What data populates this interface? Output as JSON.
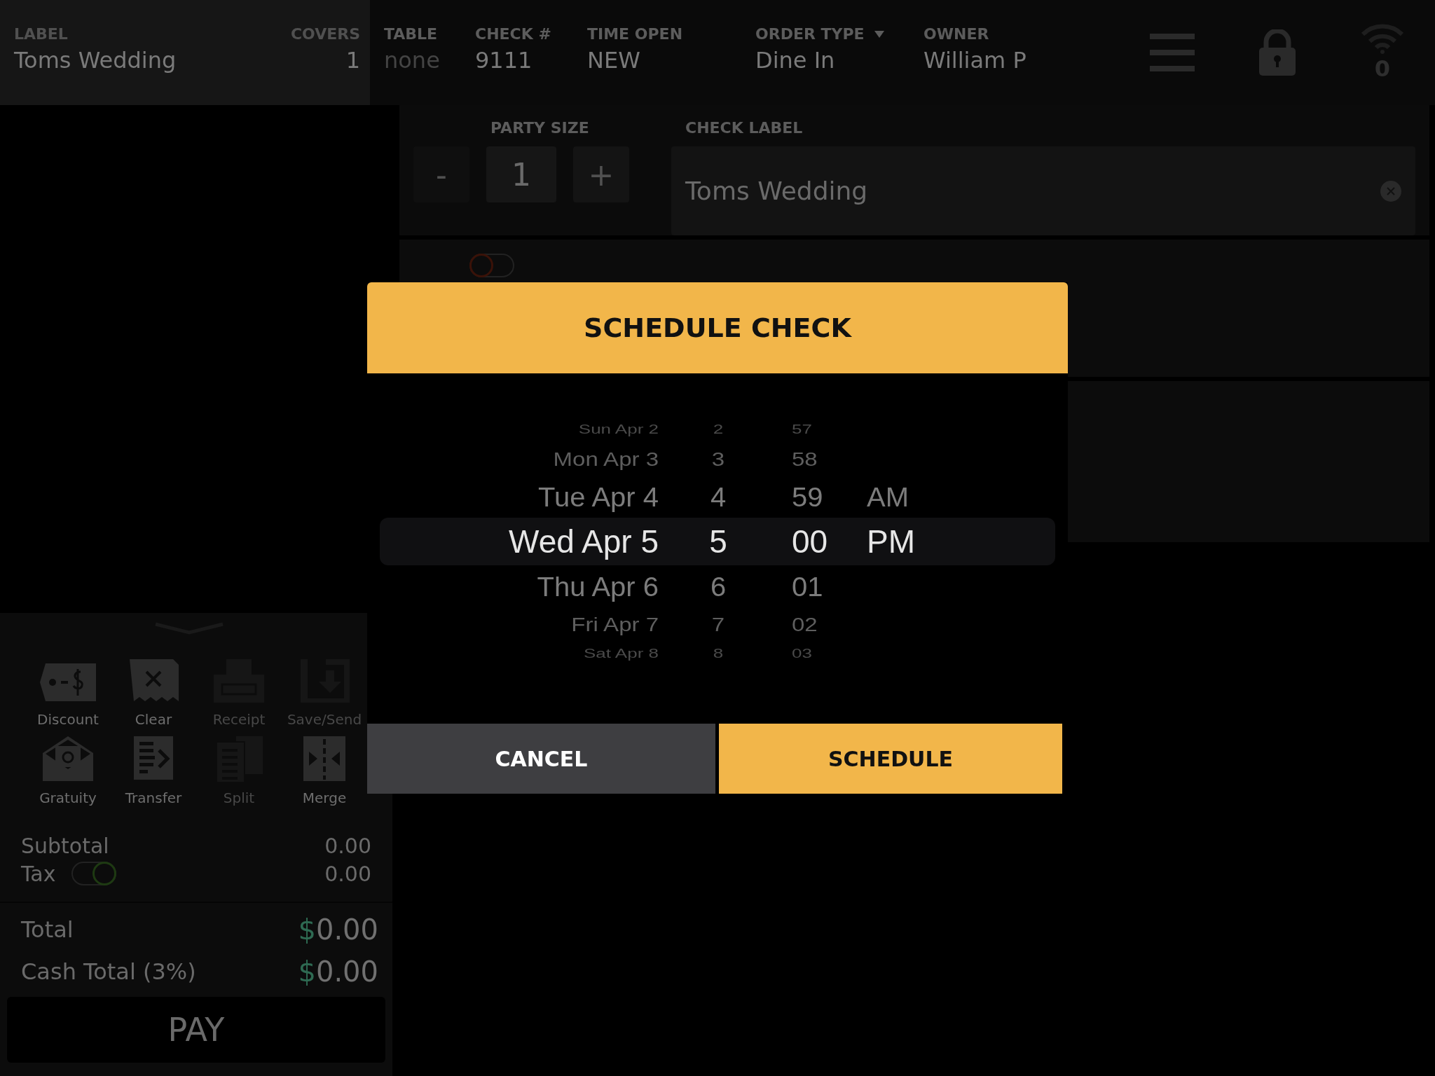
{
  "header": {
    "label": {
      "caption": "LABEL",
      "value": "Toms Wedding"
    },
    "covers": {
      "caption": "COVERS",
      "value": "1"
    },
    "fields": [
      {
        "caption": "TABLE",
        "value": "none",
        "disabled": true
      },
      {
        "caption": "CHECK #",
        "value": "9111",
        "disabled": false
      },
      {
        "caption": "TIME OPEN",
        "value": "NEW",
        "disabled": false
      },
      {
        "caption": "ORDER TYPE",
        "value": "Dine In",
        "disabled": false,
        "dropdown": true
      },
      {
        "caption": "OWNER",
        "value": "William P",
        "disabled": false
      }
    ],
    "wifi_count": "0"
  },
  "party": {
    "caption": "PARTY SIZE",
    "minus": "-",
    "value": "1",
    "plus": "+"
  },
  "check_label": {
    "caption": "CHECK LABEL",
    "value": "Toms Wedding"
  },
  "toggle": {
    "on": false
  },
  "actions": [
    {
      "label": "Discount",
      "disabled": false
    },
    {
      "label": "Clear",
      "disabled": false
    },
    {
      "label": "Receipt",
      "disabled": true
    },
    {
      "label": "Save/Send",
      "disabled": true
    },
    {
      "label": "Gratuity",
      "disabled": false
    },
    {
      "label": "Transfer",
      "disabled": false
    },
    {
      "label": "Split",
      "disabled": true
    },
    {
      "label": "Merge",
      "disabled": false
    }
  ],
  "totals": {
    "subtotal": {
      "label": "Subtotal",
      "value": "0.00"
    },
    "tax": {
      "label": "Tax",
      "value": "0.00",
      "on": true
    },
    "lines": [
      {
        "label": "Total",
        "currency": "$",
        "amount": "0.00"
      },
      {
        "label": "Cash Total (3%)",
        "currency": "$",
        "amount": "0.00"
      }
    ]
  },
  "pay": "PAY",
  "modal": {
    "title": "SCHEDULE CHECK",
    "columns": [
      {
        "kind": "date",
        "items": [
          {
            "label": "Sun Apr 2",
            "selected": false
          },
          {
            "label": "Mon Apr 3",
            "selected": false
          },
          {
            "label": "Tue Apr 4",
            "selected": false
          },
          {
            "label": "Wed Apr 5",
            "selected": true
          },
          {
            "label": "Thu Apr 6",
            "selected": false
          },
          {
            "label": "Fri Apr 7",
            "selected": false
          },
          {
            "label": "Sat Apr 8",
            "selected": false
          }
        ]
      },
      {
        "kind": "hour",
        "items": [
          {
            "label": "2",
            "selected": false
          },
          {
            "label": "3",
            "selected": false
          },
          {
            "label": "4",
            "selected": false
          },
          {
            "label": "5",
            "selected": true
          },
          {
            "label": "6",
            "selected": false
          },
          {
            "label": "7",
            "selected": false
          },
          {
            "label": "8",
            "selected": false
          }
        ]
      },
      {
        "kind": "minute",
        "items": [
          {
            "label": "57",
            "selected": false
          },
          {
            "label": "58",
            "selected": false
          },
          {
            "label": "59",
            "selected": false
          },
          {
            "label": "00",
            "selected": true
          },
          {
            "label": "01",
            "selected": false
          },
          {
            "label": "02",
            "selected": false
          },
          {
            "label": "03",
            "selected": false
          }
        ]
      },
      {
        "kind": "ampm",
        "items": [
          {
            "label": "AM",
            "selected": false
          },
          {
            "label": "PM",
            "selected": true
          }
        ]
      }
    ],
    "cancel": "CANCEL",
    "confirm": "SCHEDULE"
  }
}
